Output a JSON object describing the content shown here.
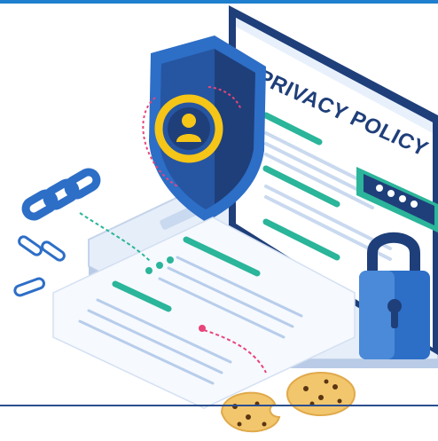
{
  "document": {
    "title": "PRIVACY POLICY"
  },
  "icons": [
    "shield-icon",
    "user-icon",
    "padlock-icon",
    "chain-link-icon",
    "paperclip-icon",
    "cookie-icon",
    "password-field-icon"
  ],
  "colors": {
    "navy": "#1f3f7a",
    "blue": "#2d6ec7",
    "light_blue": "#cfe0f5",
    "teal": "#2bb59a",
    "yellow": "#f5c518",
    "pink": "#e8457a",
    "cookie": "#f2c66d"
  }
}
